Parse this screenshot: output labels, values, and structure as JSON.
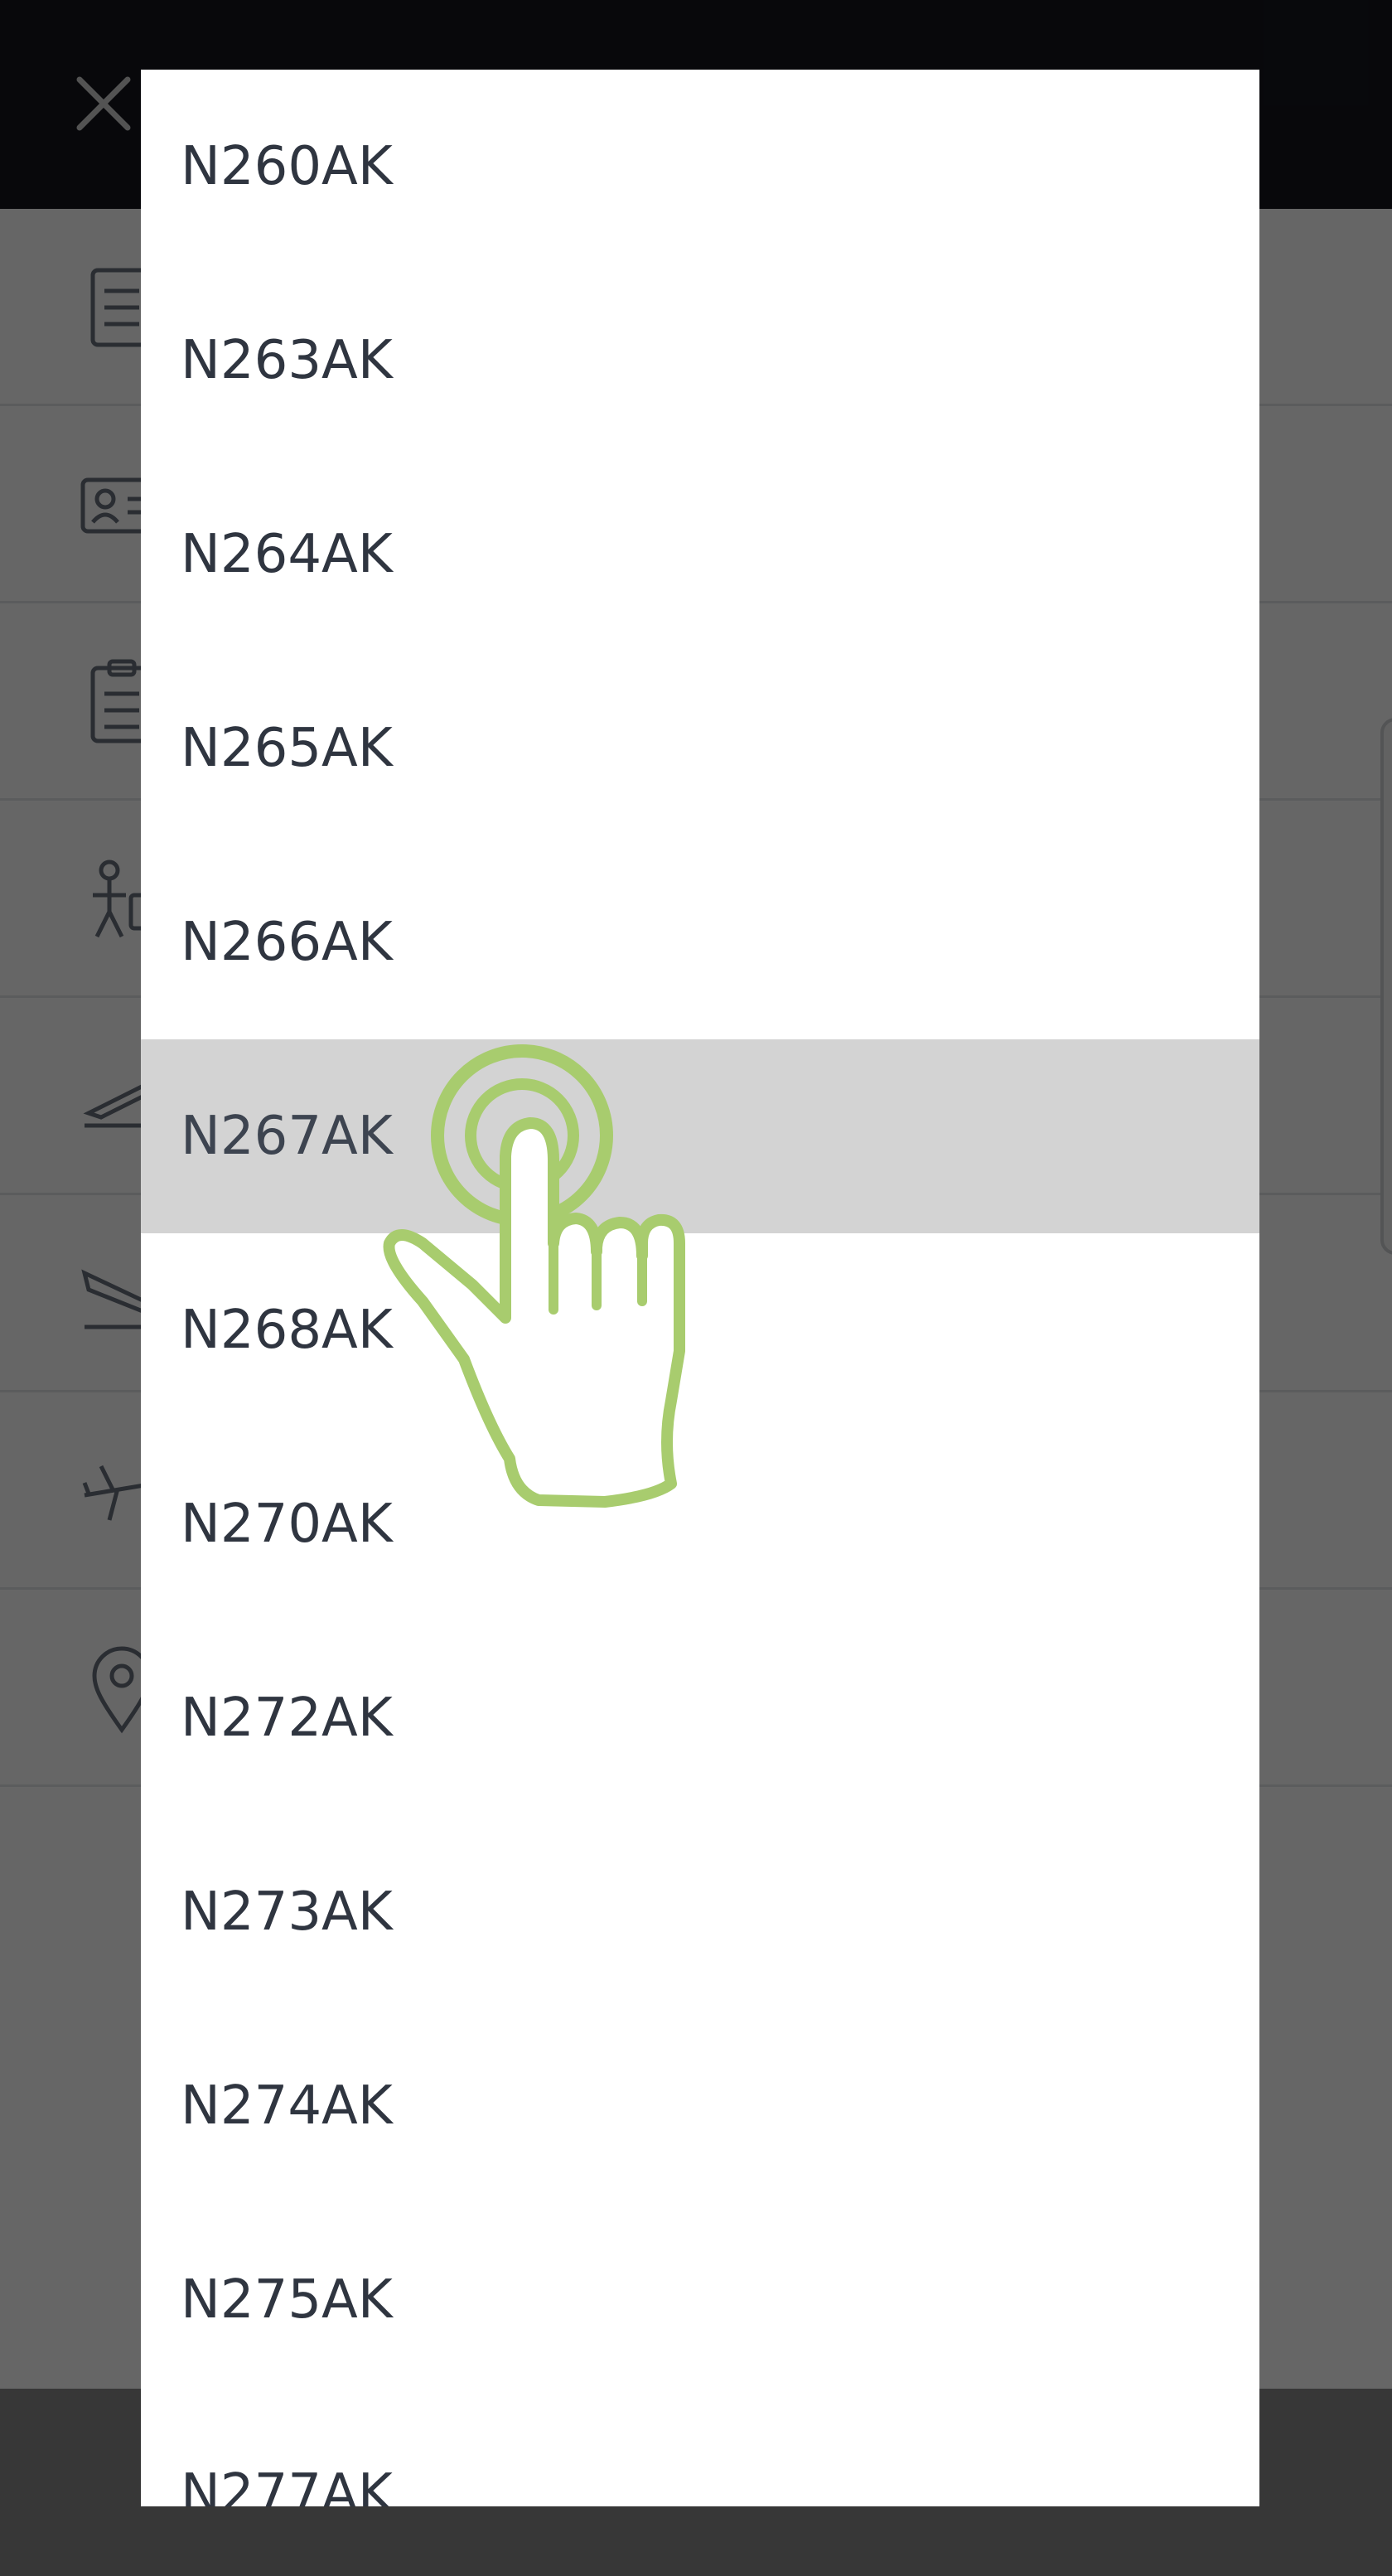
{
  "topbar": {
    "close_icon": "close-icon"
  },
  "background_rows": [
    {
      "icon": "document-icon"
    },
    {
      "icon": "id-card-icon"
    },
    {
      "icon": "clipboard-icon"
    },
    {
      "icon": "person-luggage-icon"
    },
    {
      "icon": "plane-takeoff-icon"
    },
    {
      "icon": "plane-landing-icon"
    },
    {
      "icon": "airplane-icon"
    },
    {
      "icon": "location-pin-icon"
    }
  ],
  "dropdown": {
    "options": [
      {
        "label": "N260AK"
      },
      {
        "label": "N263AK"
      },
      {
        "label": "N264AK"
      },
      {
        "label": "N265AK"
      },
      {
        "label": "N266AK"
      },
      {
        "label": "N267AK"
      },
      {
        "label": "N268AK"
      },
      {
        "label": "N270AK"
      },
      {
        "label": "N272AK"
      },
      {
        "label": "N273AK"
      },
      {
        "label": "N274AK"
      },
      {
        "label": "N275AK"
      },
      {
        "label": "N277AK"
      }
    ],
    "selected_value": "N267AK"
  },
  "tap_hint": {
    "icon": "tap-hand-icon",
    "color": "#a8cc6e"
  },
  "colors": {
    "topbar": "#15161d",
    "selected_row": "#d3d3d3",
    "option_text": "#2f3540"
  }
}
